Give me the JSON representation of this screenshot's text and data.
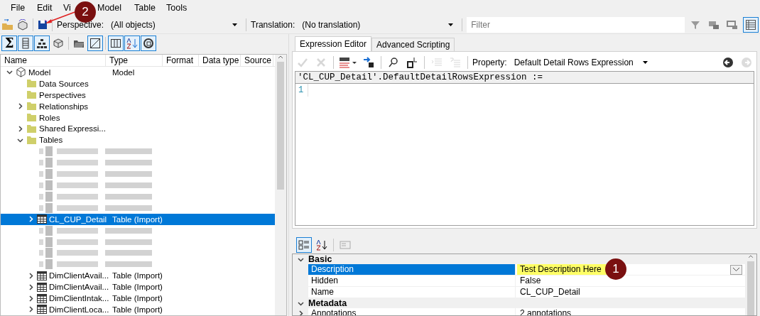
{
  "menu": [
    "File",
    "Edit",
    "Vi",
    "Model",
    "Table",
    "Tools"
  ],
  "toolbar": {
    "perspective_label": "Perspective:",
    "perspective_value": "(All objects)",
    "translation_label": "Translation:",
    "translation_value": "(No translation)",
    "filter_placeholder": "Filter",
    "view_buttons": [
      {
        "kind": "funnel",
        "active": false
      },
      {
        "kind": "screens",
        "active": false
      },
      {
        "kind": "screen",
        "active": false
      },
      {
        "kind": "list",
        "active": true
      }
    ]
  },
  "tree_toolbar": [
    {
      "kind": "sum",
      "glyph": "Σ",
      "active": true
    },
    {
      "kind": "rows",
      "active": true
    },
    {
      "kind": "hierarchy",
      "active": true
    },
    {
      "kind": "cube",
      "active": false
    },
    {
      "kind": "folder",
      "active": false
    },
    {
      "kind": "diagonal",
      "active": true
    },
    {
      "kind": "columns",
      "active": true
    },
    {
      "kind": "sort",
      "active": true
    },
    {
      "kind": "circle",
      "active": true
    }
  ],
  "tree": {
    "columns": [
      "Name",
      "Type",
      "Format",
      "Data type",
      "Source"
    ],
    "rows": [
      {
        "kind": "model",
        "name": "Model",
        "type": "Model",
        "expanded": true,
        "selected": false,
        "children": [
          {
            "kind": "folder",
            "name": "Data Sources",
            "selected": false
          },
          {
            "kind": "folder",
            "name": "Perspectives",
            "selected": false
          },
          {
            "kind": "folder",
            "name": "Relationships",
            "expanded": false,
            "selected": false
          },
          {
            "kind": "folder",
            "name": "Roles",
            "selected": false
          },
          {
            "kind": "folder",
            "name": "Shared Expressi...",
            "expanded": false,
            "selected": false
          },
          {
            "kind": "folder",
            "name": "Tables",
            "expanded": true,
            "selected": false,
            "children": [
              {
                "kind": "redacted",
                "selected": false
              },
              {
                "kind": "redacted",
                "selected": false
              },
              {
                "kind": "redacted",
                "selected": false
              },
              {
                "kind": "redacted",
                "selected": false
              },
              {
                "kind": "redacted",
                "selected": false
              },
              {
                "kind": "redacted",
                "selected": false
              },
              {
                "kind": "table",
                "name": "CL_CUP_Detail",
                "type": "Table (Import)",
                "expanded": false,
                "selected": true
              },
              {
                "kind": "redacted",
                "selected": false
              },
              {
                "kind": "redacted",
                "selected": false
              },
              {
                "kind": "redacted",
                "selected": false
              },
              {
                "kind": "redacted",
                "selected": false
              },
              {
                "kind": "table",
                "name": "DimClientAvail...",
                "type": "Table (Import)",
                "expanded": false,
                "selected": false
              },
              {
                "kind": "table",
                "name": "DimClientAvail...",
                "type": "Table (Import)",
                "expanded": false,
                "selected": false
              },
              {
                "kind": "table",
                "name": "DimClientIntak...",
                "type": "Table (Import)",
                "expanded": false,
                "selected": false
              },
              {
                "kind": "table",
                "name": "DimClientLoca...",
                "type": "Table (Import)",
                "expanded": false,
                "selected": false
              }
            ]
          }
        ]
      }
    ]
  },
  "editor": {
    "tabs": [
      {
        "label": "Expression Editor",
        "selected": true
      },
      {
        "label": "Advanced Scripting",
        "selected": false
      }
    ],
    "tools": [
      {
        "kind": "check",
        "disabled": true
      },
      {
        "kind": "cross",
        "disabled": true
      },
      {
        "kind": "dax",
        "disabled": false
      },
      {
        "kind": "arrow",
        "disabled": false
      },
      {
        "kind": "search",
        "disabled": false
      },
      {
        "kind": "replace",
        "disabled": false
      },
      {
        "kind": "indent",
        "disabled": true
      },
      {
        "kind": "comment",
        "disabled": true
      }
    ],
    "property_label": "Property:",
    "property_value": "Default Detail Rows Expression",
    "nav": [
      {
        "kind": "back",
        "disabled": false
      },
      {
        "kind": "forward",
        "disabled": true
      }
    ],
    "expression_header": "'CL_CUP_Detail'.DefaultDetailRowsExpression :=",
    "line_numbers": [
      "1"
    ]
  },
  "properties": {
    "tools": [
      {
        "kind": "categorized",
        "active": true
      },
      {
        "kind": "alphabetical",
        "active": false
      },
      {
        "kind": "pages",
        "active": false
      }
    ],
    "categories": [
      {
        "name": "Basic",
        "expanded": true,
        "rows": [
          {
            "name": "Description",
            "value": "Test Description Here",
            "selected": true,
            "highlighted": true,
            "editing": true,
            "expandable": false
          },
          {
            "name": "Hidden",
            "value": "False",
            "selected": false,
            "highlighted": false,
            "editing": false,
            "expandable": false
          },
          {
            "name": "Name",
            "value": "CL_CUP_Detail",
            "selected": false,
            "highlighted": false,
            "editing": false,
            "expandable": false
          }
        ]
      },
      {
        "name": "Metadata",
        "expanded": true,
        "rows": [
          {
            "name": "Annotations",
            "value": "2 annotations",
            "selected": false,
            "highlighted": false,
            "editing": false,
            "expandable": true
          }
        ]
      }
    ]
  },
  "annotations": [
    {
      "label": "2"
    },
    {
      "label": "1"
    }
  ]
}
